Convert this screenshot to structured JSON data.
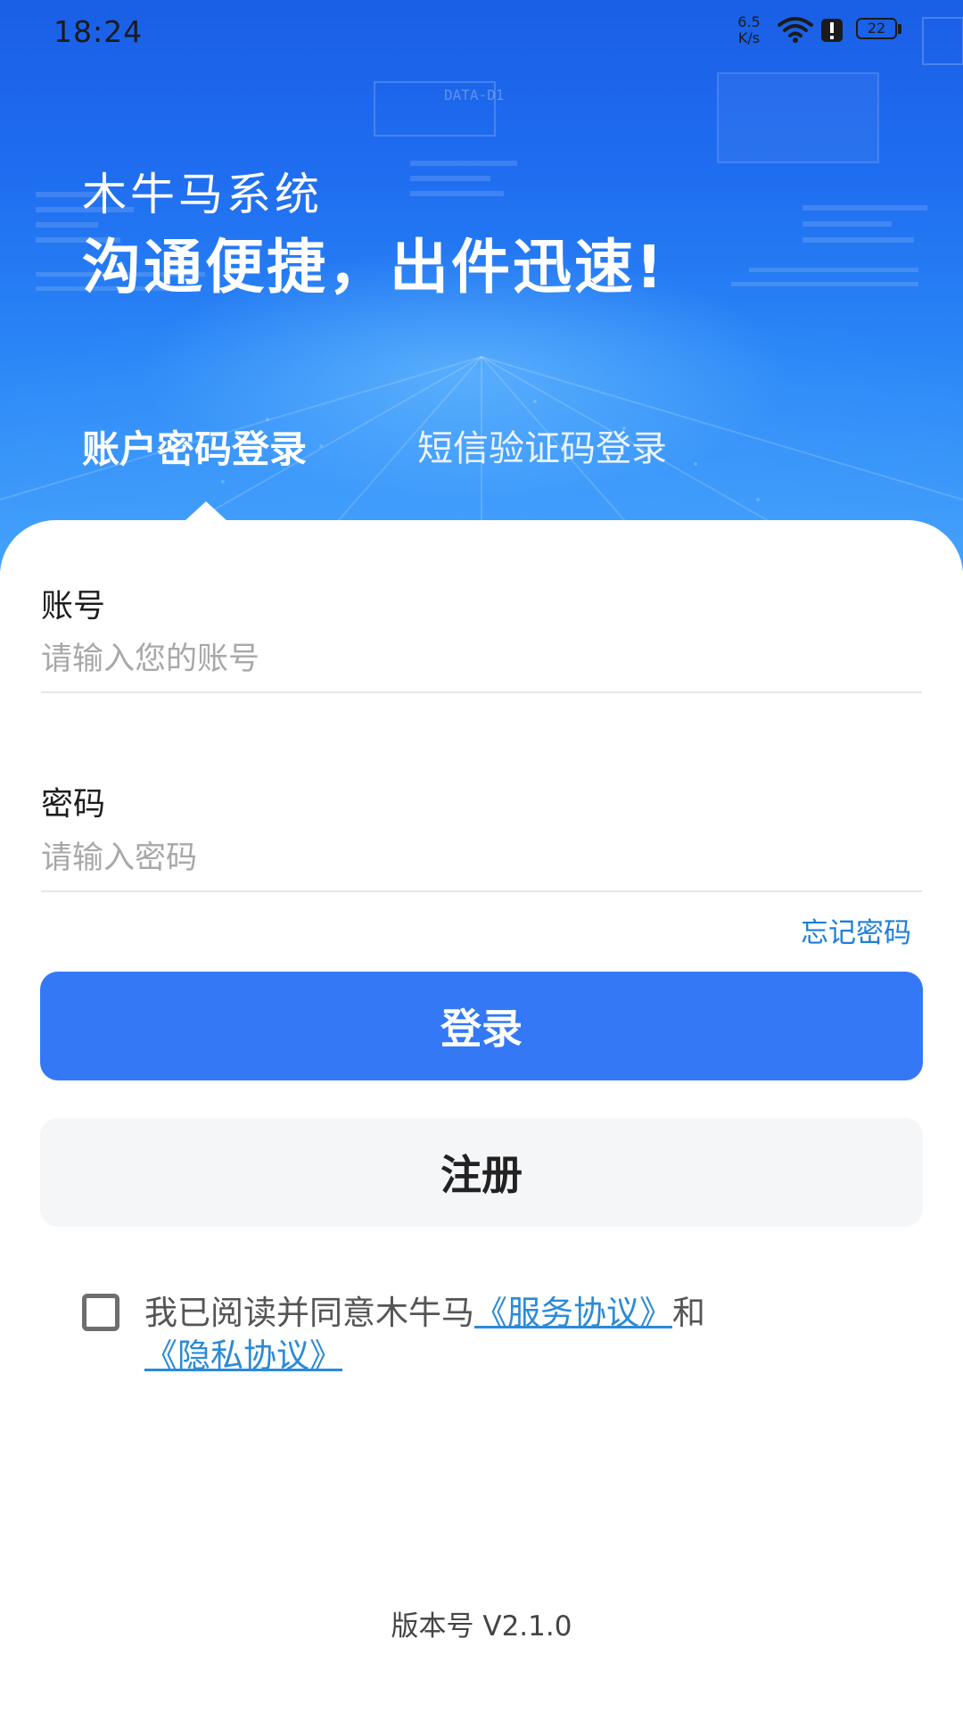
{
  "status_bar": {
    "time": "18:24",
    "net_speed_value": "6.5",
    "net_speed_unit": "K/s",
    "battery_level": "22",
    "icons": [
      "wifi-icon",
      "alert-icon",
      "battery-icon"
    ]
  },
  "hero": {
    "app_name": "木牛马系统",
    "slogan": "沟通便捷，出件迅速!",
    "decor_text": "DATA-D1"
  },
  "tabs": [
    {
      "label": "账户密码登录",
      "active": true
    },
    {
      "label": "短信验证码登录",
      "active": false
    }
  ],
  "form": {
    "account_label": "账号",
    "account_placeholder": "请输入您的账号",
    "password_label": "密码",
    "password_placeholder": "请输入密码",
    "forgot_password": "忘记密码"
  },
  "buttons": {
    "login": "登录",
    "register": "注册"
  },
  "agreement": {
    "checked": false,
    "prefix": "我已阅读并同意木牛马",
    "service_link": "《服务协议》",
    "conjunction": "和",
    "privacy_link": "《隐私协议》"
  },
  "footer": {
    "version": "版本号 V2.1.0"
  },
  "colors": {
    "primary": "#3478f6",
    "link": "#2a8ad8",
    "hero_top": "#1a5fe6",
    "hero_bottom": "#45a3fb"
  }
}
